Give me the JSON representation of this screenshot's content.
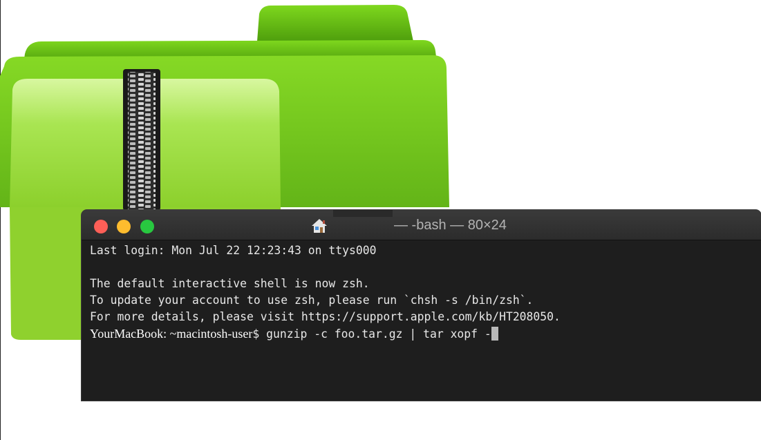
{
  "folder_icon": {
    "icon": "zipped-folder-icon",
    "color": "#7ed321"
  },
  "terminal": {
    "title": "— -bash — 80×24",
    "home_icon": "home-icon",
    "traffic_lights": {
      "close": "#fe5f57",
      "minimize": "#febc2e",
      "maximize": "#28c840"
    },
    "lines": [
      "Last login: Mon Jul 22 12:23:43 on ttys000",
      "",
      "The default interactive shell is now zsh.",
      "To update your account to use zsh, please run `chsh -s /bin/zsh`.",
      "For more details, please visit https://support.apple.com/kb/HT208050."
    ],
    "prompt": "YourMacBook: ~macintosh-user",
    "command": "$ gunzip -c foo.tar.gz | tar xopf -",
    "background": "#1e1e1e",
    "text_color": "#e8e8e8"
  }
}
